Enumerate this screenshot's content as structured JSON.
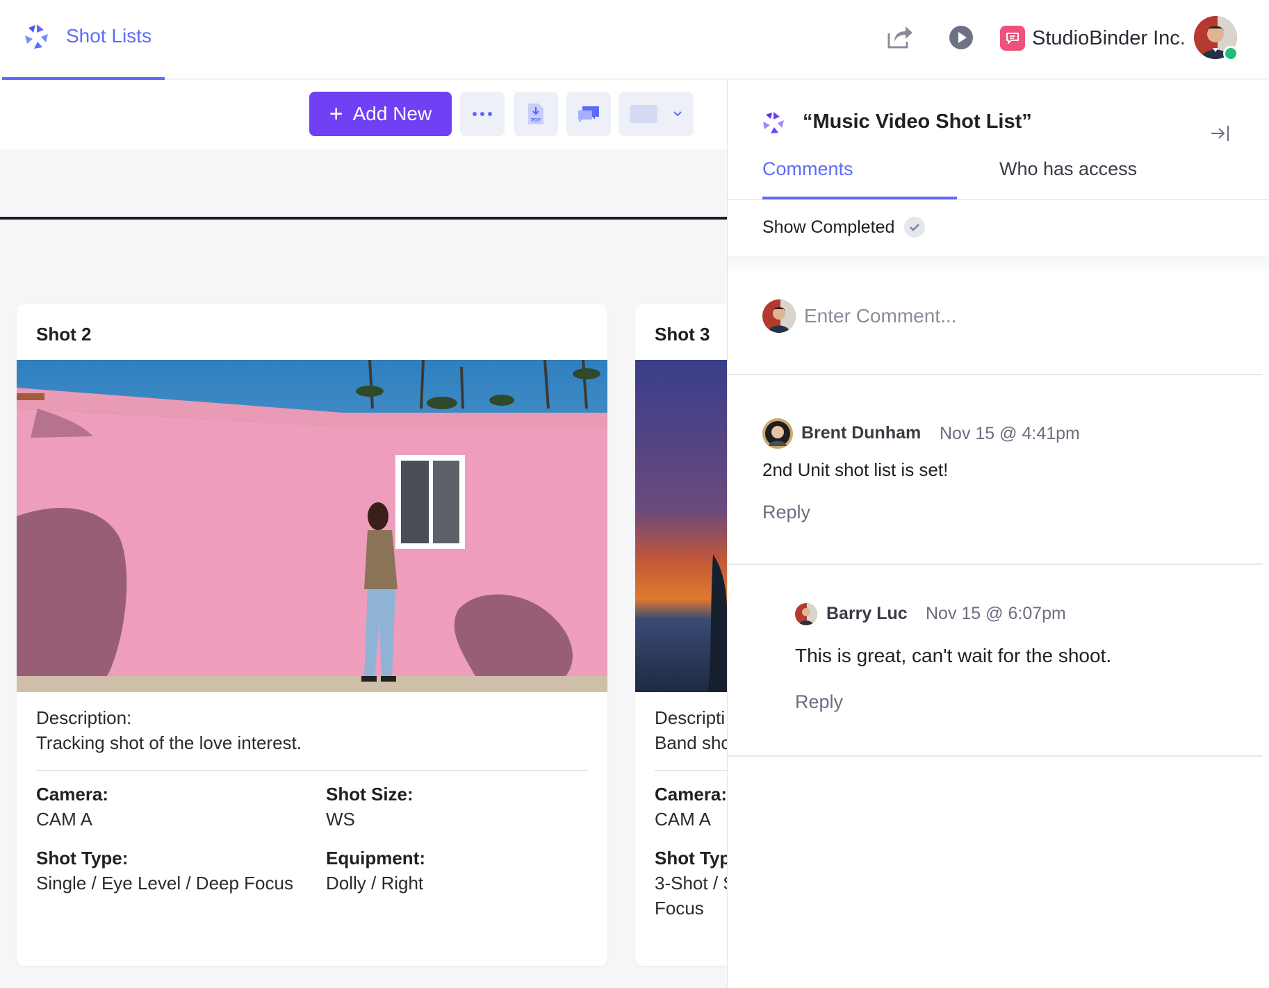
{
  "header": {
    "tab_label": "Shot Lists",
    "company_name": "StudioBinder Inc."
  },
  "toolbar": {
    "add_new_label": "Add New",
    "pdf_label": "PDF"
  },
  "shots": [
    {
      "title": "Shot  2",
      "description_label": "Description:",
      "description": "Tracking shot of the love interest.",
      "camera_label": "Camera:",
      "camera": "CAM A",
      "shot_size_label": "Shot Size:",
      "shot_size": "WS",
      "shot_type_label": "Shot Type:",
      "shot_type": "Single / Eye Level / Deep Focus",
      "equipment_label": "Equipment:",
      "equipment": "Dolly / Right"
    },
    {
      "title": "Shot  3",
      "description_label": "Descripti",
      "description": "Band sho",
      "camera_label": "Camera:",
      "camera": "CAM A",
      "shot_type_label": "Shot Typ",
      "shot_type_line1": "3-Shot / S",
      "shot_type_line2": "Focus"
    }
  ],
  "panel": {
    "title": "“Music Video Shot List”",
    "tabs": [
      "Comments",
      "Who has access"
    ],
    "show_completed_label": "Show Completed",
    "comment_placeholder": "Enter Comment...",
    "comments": [
      {
        "author": "Brent Dunham",
        "time": "Nov 15 @ 4:41pm",
        "text": "2nd Unit shot list is set!",
        "reply_label": "Reply"
      },
      {
        "author": "Barry Luc",
        "time": "Nov 15 @ 6:07pm",
        "text": "This is great, can't wait for the shoot.",
        "reply_label": "Reply"
      }
    ]
  },
  "colors": {
    "accent": "#5b6cf9",
    "primary_button": "#7040f5",
    "online": "#1fbf7a",
    "company_badge": "#f0507a"
  },
  "icons": {
    "app_logo": "aperture-logo-icon",
    "share": "share-icon",
    "play": "play-icon",
    "more": "ellipsis-icon",
    "pdf": "pdf-download-icon",
    "chat": "chat-icon",
    "collapse": "collapse-panel-icon",
    "check": "check-icon"
  }
}
